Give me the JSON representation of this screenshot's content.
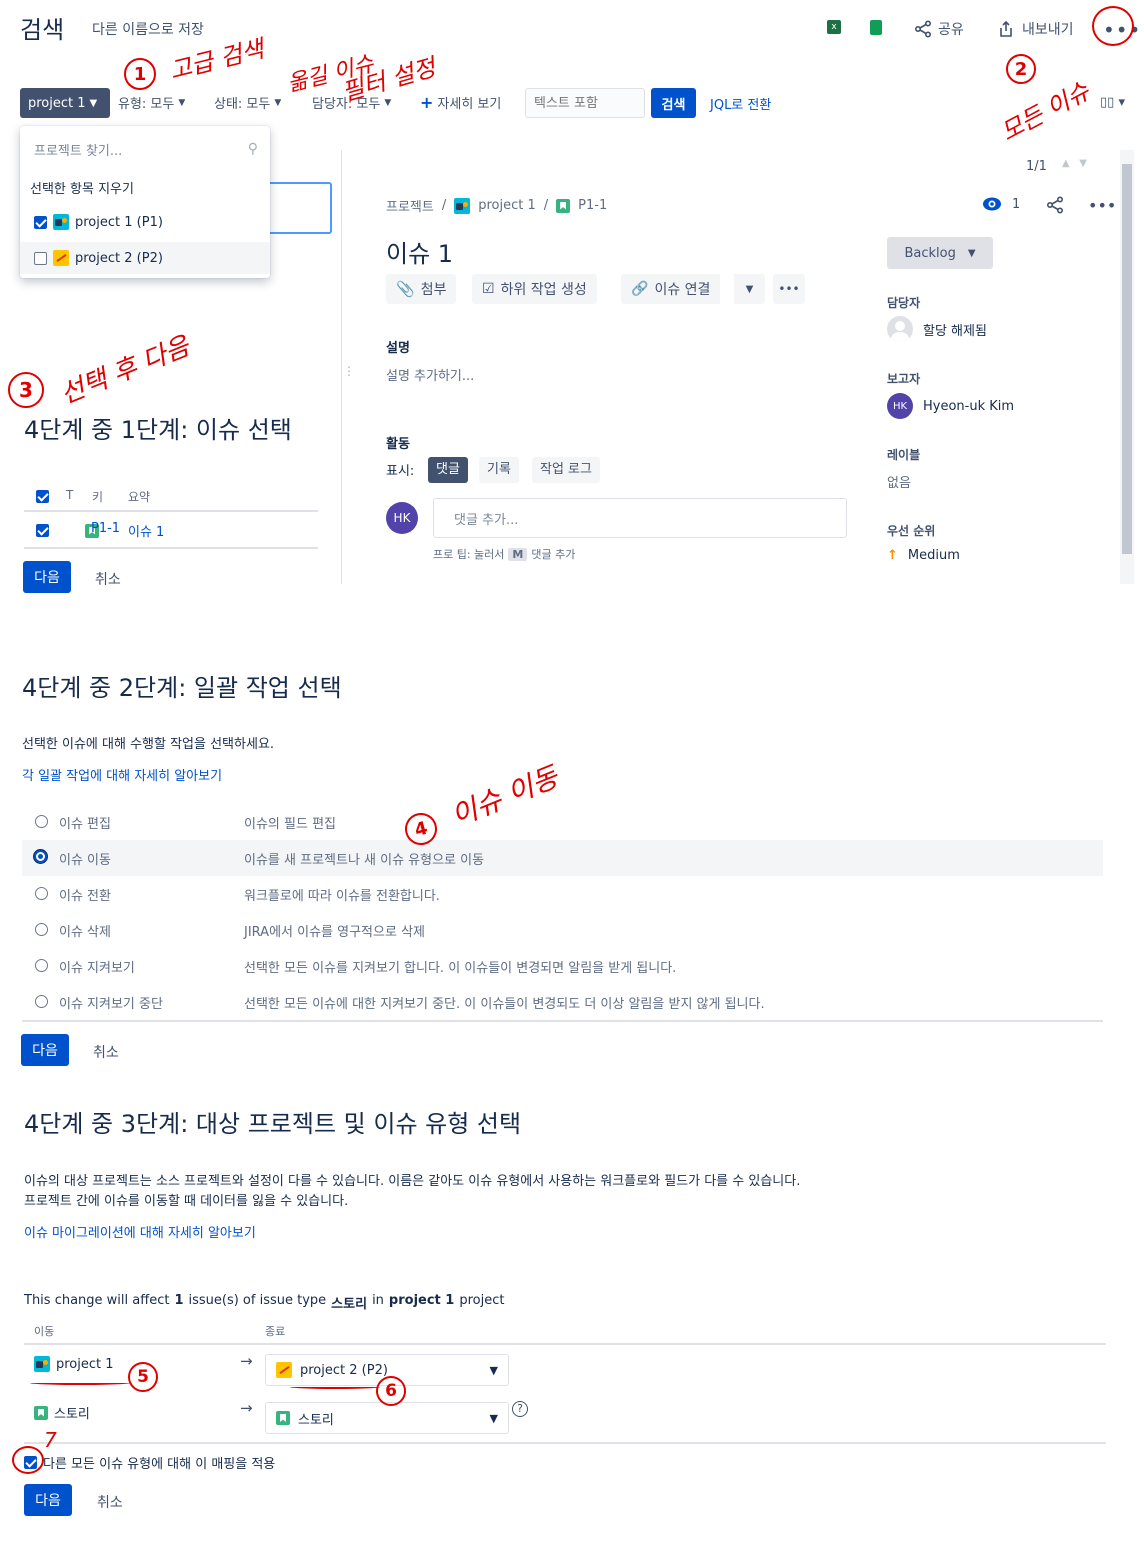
{
  "header": {
    "title": "검색",
    "save_as": "다른 이름으로 저장",
    "share": "공유",
    "export": "내보내기"
  },
  "filters": {
    "project": "project 1",
    "type": "유형: 모두",
    "status": "상태: 모두",
    "assignee": "담당자: 모두",
    "more": "자세히 보기",
    "text_placeholder": "텍스트 포함",
    "search": "검색",
    "jql": "JQL로 전환"
  },
  "project_dropdown": {
    "placeholder": "프로젝트 찾기...",
    "clear": "선택한 항목 지우기",
    "items": [
      {
        "label": "project 1 (P1)",
        "checked": true
      },
      {
        "label": "project 2 (P2)",
        "checked": false
      }
    ]
  },
  "annotations": {
    "a1_num": "1",
    "a1_text1": "고급 검색",
    "a1_text2": "옮길 이슈",
    "a1_text3": "필터 설정",
    "a2_num": "2",
    "a2_text": "모든 이슈",
    "a3_num": "3",
    "a3_text": "선택 후 다음",
    "a4_num": "4",
    "a4_text": "이슈 이동",
    "a5_num": "5",
    "a6_num": "6",
    "a7_num": "7"
  },
  "detail": {
    "pager": "1/1",
    "breadcrumb": [
      "프로젝트",
      "project 1",
      "P1-1"
    ],
    "title": "이슈 1",
    "watch_count": "1",
    "actions": [
      "첨부",
      "하위 작업 생성",
      "이슈 연결"
    ],
    "description_label": "설명",
    "description_placeholder": "설명 추가하기...",
    "activity_label": "활동",
    "show_label": "표시:",
    "activity_tabs": [
      "댓글",
      "기록",
      "작업 로그"
    ],
    "avatar_initials": "HK",
    "comment_placeholder": "댓글 추가...",
    "tip_prefix": "프로 팁: 눌러서",
    "tip_key": "M",
    "tip_suffix": "댓글 추가",
    "status": "Backlog",
    "assignee_label": "담당자",
    "assignee_value": "할당 해제됨",
    "reporter_label": "보고자",
    "reporter_value": "Hyeon-uk Kim",
    "labels_label": "레이블",
    "labels_value": "없음",
    "priority_label": "우선 순위",
    "priority_value": "Medium",
    "priority_color": "#ff8b00"
  },
  "step1": {
    "title": "4단계 중 1단계: 이슈 선택",
    "headers": [
      "T",
      "키",
      "요약"
    ],
    "rows": [
      {
        "key": "P1-1",
        "summary": "이슈 1"
      }
    ],
    "next": "다음",
    "cancel": "취소"
  },
  "step2": {
    "title": "4단계 중 2단계: 일괄 작업 선택",
    "intro": "선택한 이슈에 대해 수행할 작업을 선택하세요.",
    "learn": "각 일괄 작업에 대해 자세히 알아보기",
    "options": [
      {
        "label": "이슈 편집",
        "desc": "이슈의 필드 편집",
        "selected": false
      },
      {
        "label": "이슈 이동",
        "desc": "이슈를 새 프로젝트나 새 이슈 유형으로 이동",
        "selected": true
      },
      {
        "label": "이슈 전환",
        "desc": "워크플로에 따라 이슈를 전환합니다.",
        "selected": false
      },
      {
        "label": "이슈 삭제",
        "desc": "JIRA에서 이슈를 영구적으로 삭제",
        "selected": false
      },
      {
        "label": "이슈 지켜보기",
        "desc": "선택한 모든 이슈를 지켜보기 합니다. 이 이슈들이 변경되면 알림을 받게 됩니다.",
        "selected": false
      },
      {
        "label": "이슈 지켜보기 중단",
        "desc": "선택한 모든 이슈에 대한 지켜보기 중단. 이 이슈들이 변경되도 더 이상 알림을 받지 않게 됩니다.",
        "selected": false
      }
    ],
    "next": "다음",
    "cancel": "취소"
  },
  "step3": {
    "title": "4단계 중 3단계: 대상 프로젝트 및 이슈 유형 선택",
    "intro1": "이슈의 대상 프로젝트는 소스 프로젝트와 설정이 다를 수 있습니다. 이름은 같아도 이슈 유형에서 사용하는 워크플로와 필드가 다를 수 있습니다.",
    "intro2": "프로젝트 간에 이슈를 이동할 때 데이터를 잃을 수 있습니다.",
    "learn": "이슈 마이그레이션에 대해 자세히 알아보기",
    "affect_prefix": "This change will affect",
    "affect_count": "1",
    "affect_mid": "issue(s) of issue type",
    "affect_type": "스토리",
    "affect_in": "in",
    "affect_project": "project 1",
    "affect_suffix": "project",
    "col_move": "이동",
    "col_target": "종료",
    "source_project": "project 1",
    "target_project": "project 2 (P2)",
    "source_type": "스토리",
    "target_type": "스토리",
    "apply_all": "다른 모든 이슈 유형에 대해 이 매핑을 적용",
    "next": "다음",
    "cancel": "취소"
  }
}
